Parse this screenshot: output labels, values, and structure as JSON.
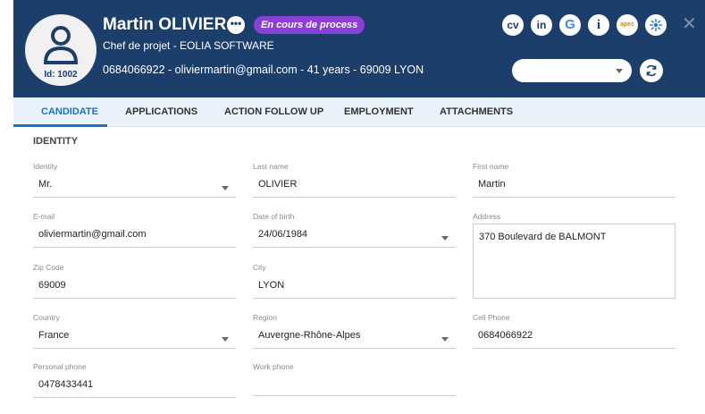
{
  "header": {
    "id_label": "Id: 1002",
    "name": "Martin OLIVIER",
    "more_label": "•••",
    "status": "En cours de process",
    "subtitle": "Chef de projet - EOLIA SOFTWARE",
    "contact": "0684066922 - oliviermartin@gmail.com - 41 years - 69009 LYON",
    "icons": [
      {
        "name": "cv-icon",
        "text": "cv"
      },
      {
        "name": "linkedin-icon",
        "text": "in"
      },
      {
        "name": "google-icon",
        "text": "G"
      },
      {
        "name": "info-icon",
        "text": "i"
      },
      {
        "name": "apec-icon",
        "text": "apec"
      },
      {
        "name": "pole-emploi-icon",
        "text": ""
      }
    ],
    "select_value": "",
    "close_label": "✕"
  },
  "colors": {
    "header_bg": "#1c3e6a",
    "status_badge": "#8a3fd6",
    "tab_active": "#1a73c8",
    "tabs_bg": "#e9f1fa"
  },
  "tabs": [
    {
      "label": "CANDIDATE",
      "active": true
    },
    {
      "label": "APPLICATIONS",
      "active": false
    },
    {
      "label": "ACTION FOLLOW UP",
      "active": false
    },
    {
      "label": "EMPLOYMENT",
      "active": false
    },
    {
      "label": "ATTACHMENTS",
      "active": false
    }
  ],
  "form": {
    "section_title": "IDENTITY",
    "identity": {
      "label": "Identity",
      "value": "Mr."
    },
    "last_name": {
      "label": "Last name",
      "value": "OLIVIER"
    },
    "first_name": {
      "label": "First name",
      "value": "Martin"
    },
    "email": {
      "label": "E-mail",
      "value": "oliviermartin@gmail.com"
    },
    "dob": {
      "label": "Date of birth",
      "value": "24/06/1984"
    },
    "address": {
      "label": "Address",
      "value": "370 Boulevard de BALMONT"
    },
    "zip": {
      "label": "Zip Code",
      "value": "69009"
    },
    "city": {
      "label": "City",
      "value": "LYON"
    },
    "country": {
      "label": "Country",
      "value": "France"
    },
    "region": {
      "label": "Region",
      "value": "Auvergne-Rhône-Alpes"
    },
    "cell_phone": {
      "label": "Cell Phone",
      "value": "0684066922"
    },
    "personal_phone": {
      "label": "Personal phone",
      "value": "0478433441"
    },
    "work_phone": {
      "label": "Work phone",
      "value": ""
    }
  }
}
